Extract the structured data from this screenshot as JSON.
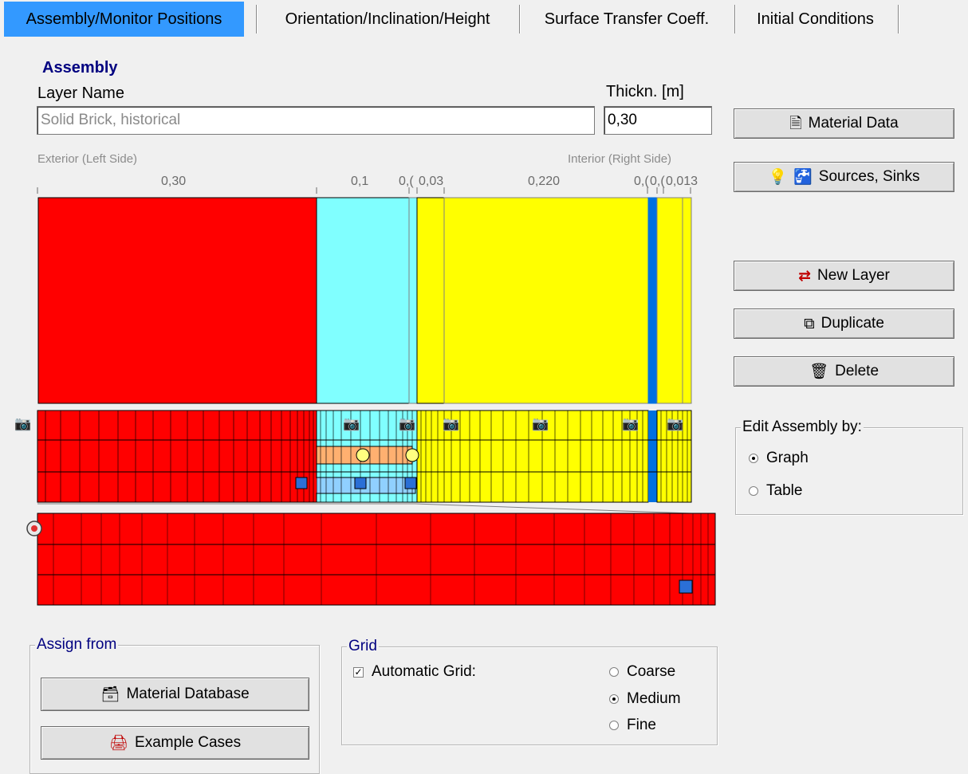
{
  "tabs": [
    {
      "label": "Assembly/Monitor Positions",
      "active": true
    },
    {
      "label": "Orientation/Inclination/Height",
      "active": false
    },
    {
      "label": "Surface Transfer Coeff.",
      "active": false
    },
    {
      "label": "Initial Conditions",
      "active": false
    }
  ],
  "assembly": {
    "heading": "Assembly",
    "layer_name_label": "Layer Name",
    "layer_name_value": "Solid Brick, historical",
    "thickness_label": "Thickn. [m]",
    "thickness_value": "0,30",
    "exterior_label": "Exterior (Left Side)",
    "interior_label": "Interior (Right Side)",
    "layer_thickness_labels": [
      "0,30",
      "0,1",
      "0,(",
      "0,03",
      "0,220",
      "0,(",
      "0,(",
      "0,013"
    ]
  },
  "layers": [
    {
      "material": "Solid Brick, historical",
      "color": "#ff0000",
      "thickness": 0.3
    },
    {
      "material": "",
      "color": "#80ffff",
      "thickness": 0.1
    },
    {
      "material": "",
      "color": "#80ffff",
      "thickness": 0.005
    },
    {
      "material": "",
      "color": "#ffff00",
      "thickness": 0.005
    },
    {
      "material": "",
      "color": "#ffff00",
      "thickness": 0.03
    },
    {
      "material": "",
      "color": "#ffff00",
      "thickness": 0.22
    },
    {
      "material": "",
      "color": "#0070e0",
      "thickness": 0.005
    },
    {
      "material": "",
      "color": "#ffff00",
      "thickness": 0.005
    },
    {
      "material": "",
      "color": "#ffff00",
      "thickness": 0.013
    }
  ],
  "actions": {
    "material_data": "Material Data",
    "sources_sinks": "Sources, Sinks",
    "new_layer": "New Layer",
    "duplicate": "Duplicate",
    "delete": "Delete"
  },
  "edit_by": {
    "title": "Edit Assembly by:",
    "options": [
      {
        "label": "Graph",
        "selected": true
      },
      {
        "label": "Table",
        "selected": false
      }
    ]
  },
  "assign_from": {
    "title": "Assign from",
    "material_database": "Material Database",
    "example_cases": "Example Cases"
  },
  "grid": {
    "title": "Grid",
    "automatic_label": "Automatic Grid:",
    "automatic_checked": true,
    "options": [
      {
        "label": "Coarse",
        "selected": false
      },
      {
        "label": "Medium",
        "selected": true
      },
      {
        "label": "Fine",
        "selected": false
      }
    ]
  },
  "icons": [
    "document-icon",
    "bulb-icon",
    "faucet-icon",
    "new-layer-icon",
    "duplicate-icon",
    "trash-icon",
    "database-icon",
    "example-cases-icon",
    "monitor-icon"
  ]
}
